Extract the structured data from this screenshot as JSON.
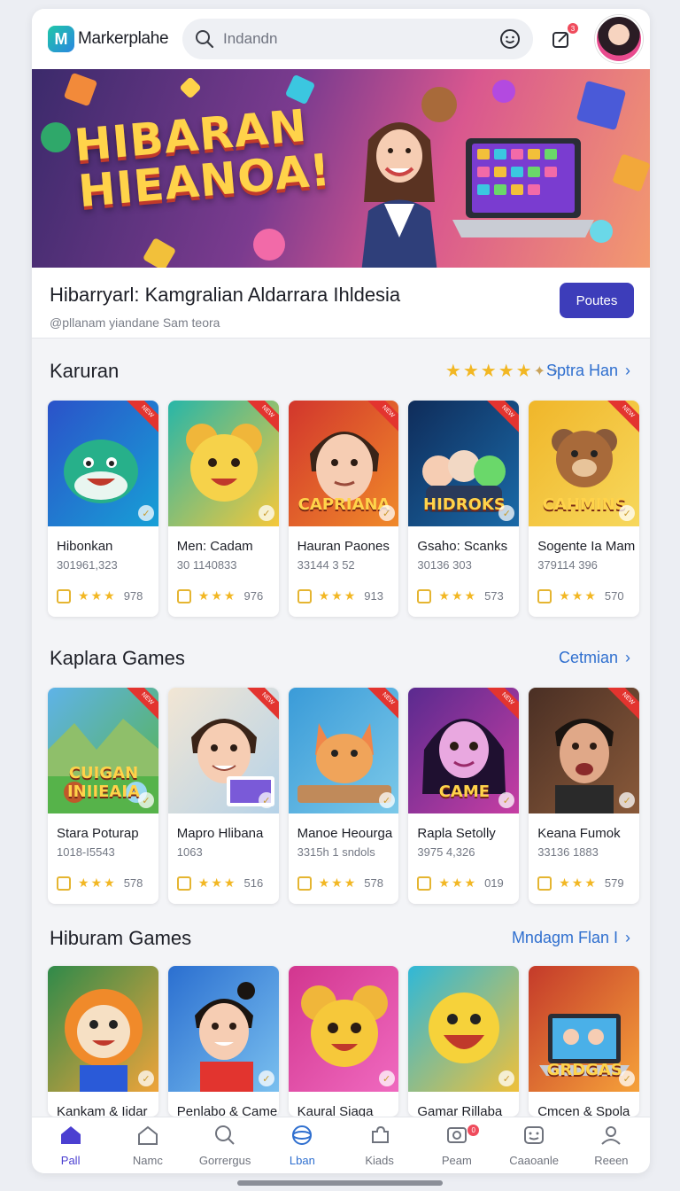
{
  "app": {
    "name": "Markerplahe"
  },
  "search": {
    "placeholder": "Indandn"
  },
  "notifications": {
    "count": "3"
  },
  "hero": {
    "title_line1": "HIBARAN",
    "title_line2": "HIEANOA!"
  },
  "promo": {
    "title": "Hibarryarl: Kamgralian Aldarrara Ihldesia",
    "subtitle": "@pllanam yiandane Sam teora",
    "button_label": "Poutes"
  },
  "sections": [
    {
      "title": "Karuran",
      "link": "Sptra Han",
      "stars": 5.5,
      "cards": [
        {
          "name": "Hibonkan",
          "meta": "301961,323",
          "rating": "978",
          "art": "whale",
          "label": "",
          "colors": [
            "#2b52c9",
            "#17a0d6"
          ]
        },
        {
          "name": "Men: Cadam",
          "meta": "30 1140833",
          "rating": "976",
          "art": "mouse",
          "label": "",
          "colors": [
            "#27b6a8",
            "#f6c83a"
          ]
        },
        {
          "name": "Hauran Paones",
          "meta": "33144 3 52",
          "rating": "913",
          "art": "boy",
          "label": "CAPRIANA",
          "colors": [
            "#d2362c",
            "#f08a2a"
          ]
        },
        {
          "name": "Gsaho: Scanks",
          "meta": "30136 303",
          "rating": "573",
          "art": "group",
          "label": "HIDROKS",
          "colors": [
            "#0f2c5a",
            "#1a6aa8"
          ]
        },
        {
          "name": "Sogente Ia Mam",
          "meta": "379114 396",
          "rating": "570",
          "art": "bear",
          "label": "CAHMINS",
          "colors": [
            "#f0b62a",
            "#f7d85c"
          ]
        }
      ]
    },
    {
      "title": "Kaplara Games",
      "link": "Cetmian",
      "cards": [
        {
          "name": "Stara Poturap",
          "meta": "1018-I5543",
          "rating": "578",
          "art": "field",
          "label": "CUIGAN INIIEAIA",
          "colors": [
            "#5fb3e8",
            "#56b34a"
          ]
        },
        {
          "name": "Mapro Hlibana",
          "meta": "1063",
          "rating": "516",
          "art": "boy2",
          "label": "",
          "colors": [
            "#f2e6d4",
            "#b5d2e8"
          ]
        },
        {
          "name": "Manoe Heourga",
          "meta": "3315h 1 sndols",
          "rating": "578",
          "art": "fox",
          "label": "",
          "colors": [
            "#3a9bd8",
            "#7cc9e9"
          ]
        },
        {
          "name": "Rapla Setolly",
          "meta": "3975 4,326",
          "rating": "019",
          "art": "girl",
          "label": "CAME",
          "colors": [
            "#5a2a8f",
            "#c73ea3"
          ]
        },
        {
          "name": "Keana Fumok",
          "meta": "33136 1883",
          "rating": "579",
          "art": "man",
          "label": "",
          "colors": [
            "#4a2f24",
            "#8a5a3a"
          ]
        }
      ]
    },
    {
      "title": "Hiburam Games",
      "link": "Mndagm Flan I",
      "cards": [
        {
          "name": "Kankam & Iidar",
          "art": "lion",
          "label": "",
          "colors": [
            "#2f8a4a",
            "#f0a43a"
          ]
        },
        {
          "name": "Penlabo & Came",
          "art": "kid",
          "label": "",
          "colors": [
            "#2b6fd0",
            "#7ac0ef"
          ]
        },
        {
          "name": "Kaural Siaga",
          "art": "mouse2",
          "label": "",
          "colors": [
            "#d2368f",
            "#f06ac0"
          ]
        },
        {
          "name": "Gamar Rillaba",
          "art": "smile",
          "label": "",
          "colors": [
            "#2fb8d8",
            "#f0c03a"
          ]
        },
        {
          "name": "Cmcen & Spola",
          "art": "laptop",
          "label": "GRDGAS",
          "colors": [
            "#c43a2a",
            "#f6a23a"
          ]
        }
      ]
    }
  ],
  "bottom_nav": [
    {
      "label": "Pall",
      "icon": "home-icon",
      "active": true
    },
    {
      "label": "Namc",
      "icon": "house-outline-icon"
    },
    {
      "label": "Gorrergus",
      "icon": "search-icon"
    },
    {
      "label": "Lban",
      "icon": "globe-icon"
    },
    {
      "label": "Kiads",
      "icon": "puzzle-icon"
    },
    {
      "label": "Peam",
      "icon": "chat-icon",
      "badge": "0"
    },
    {
      "label": "Caaoanle",
      "icon": "face-icon"
    },
    {
      "label": "Reeen",
      "icon": "user-icon"
    }
  ],
  "colors": {
    "accent": "#3d3dba",
    "link": "#2f6fcf",
    "star": "#f2b723",
    "active_nav": "#4b3fd1"
  }
}
